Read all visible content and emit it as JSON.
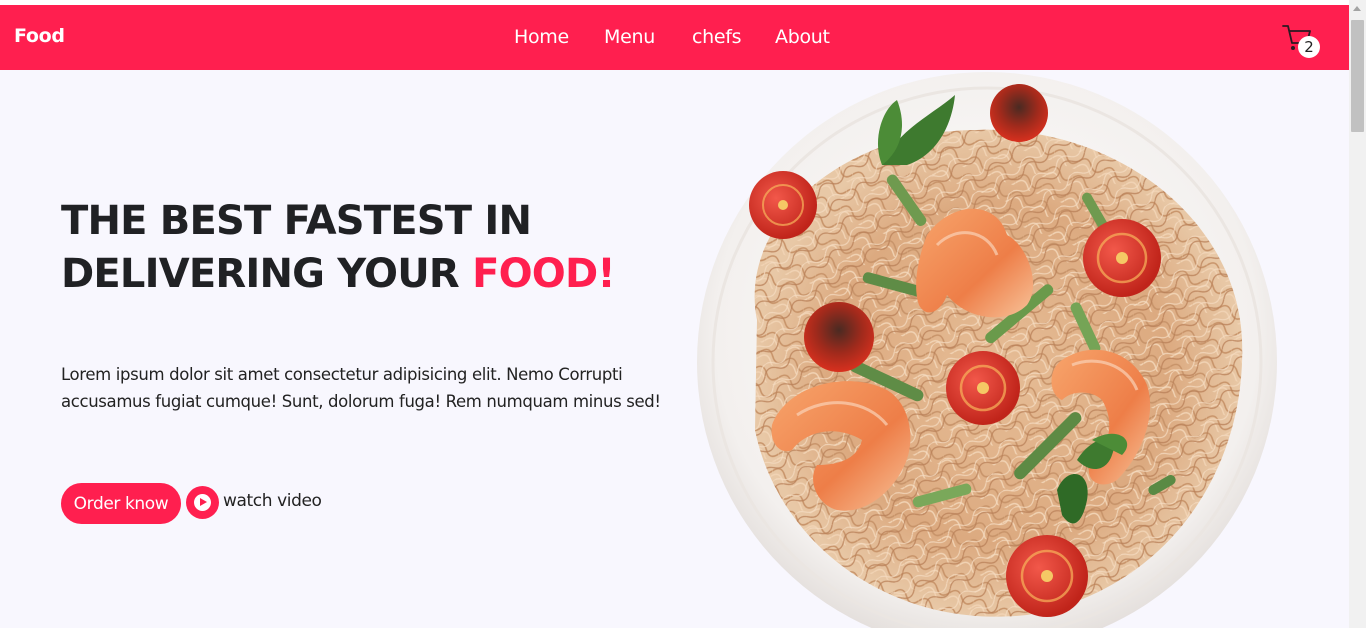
{
  "navbar": {
    "brand": "Food",
    "links": [
      {
        "label": "Home"
      },
      {
        "label": "Menu"
      },
      {
        "label": "chefs"
      },
      {
        "label": "About"
      }
    ],
    "cart_icon": "cart-icon",
    "cart_count": "2"
  },
  "hero": {
    "title_line1": "THE BEST FASTEST IN",
    "title_line2_part1": "DELIVERING YOUR ",
    "title_line2_accent": "FOOD!",
    "description": "Lorem ipsum dolor sit amet consectetur adipisicing elit. Nemo Corrupti accusamus fugiat cumque! Sunt, dolorum fuga! Rem numquam minus sed!",
    "order_button": "Order know",
    "play_icon": "play-icon",
    "watch_label": "watch video"
  },
  "colors": {
    "brand": "#ff1f4f",
    "background": "#f8f7fe",
    "text": "#202124"
  }
}
